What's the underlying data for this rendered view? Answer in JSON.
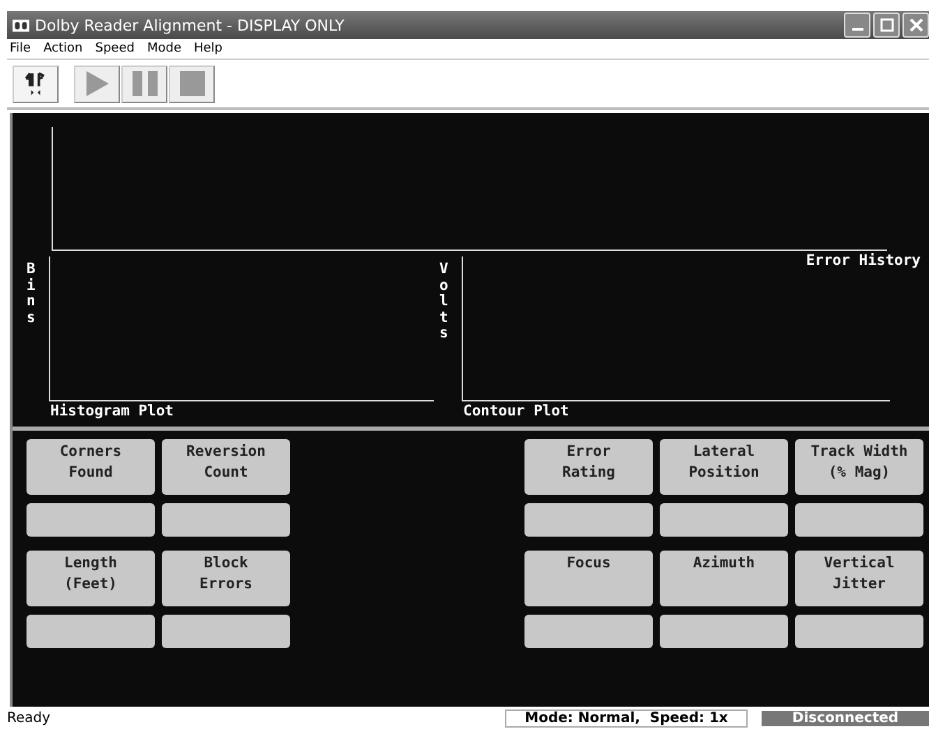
{
  "window": {
    "title": "Dolby Reader Alignment - DISPLAY ONLY"
  },
  "menu": [
    "File",
    "Action",
    "Speed",
    "Mode",
    "Help"
  ],
  "toolbar": [
    {
      "kind": "align",
      "disabled": false
    },
    {
      "kind": "play",
      "disabled": true
    },
    {
      "kind": "pause",
      "disabled": true
    },
    {
      "kind": "stop",
      "disabled": true
    }
  ],
  "plots": {
    "error_history": {
      "title": "Error History"
    },
    "histogram": {
      "title": "Histogram Plot",
      "ylabel": "Bins"
    },
    "contour": {
      "title": "Contour Plot",
      "ylabel": "Volts"
    }
  },
  "meters_left": [
    [
      {
        "label": "Corners\nFound"
      },
      {
        "label": "Reversion\nCount"
      }
    ],
    [
      {
        "label": "Length\n(Feet)"
      },
      {
        "label": "Block\nErrors"
      }
    ]
  ],
  "meters_right": [
    [
      {
        "label": "Error\nRating"
      },
      {
        "label": "Lateral\nPosition"
      },
      {
        "label": "Track Width\n(% Mag)"
      }
    ],
    [
      {
        "label": "Focus"
      },
      {
        "label": "Azimuth"
      },
      {
        "label": "Vertical\nJitter"
      }
    ]
  ],
  "status_bar": {
    "message": "Ready",
    "mode": "Mode: Normal,  Speed: 1x",
    "connection": "Disconnected",
    "connected": false
  }
}
